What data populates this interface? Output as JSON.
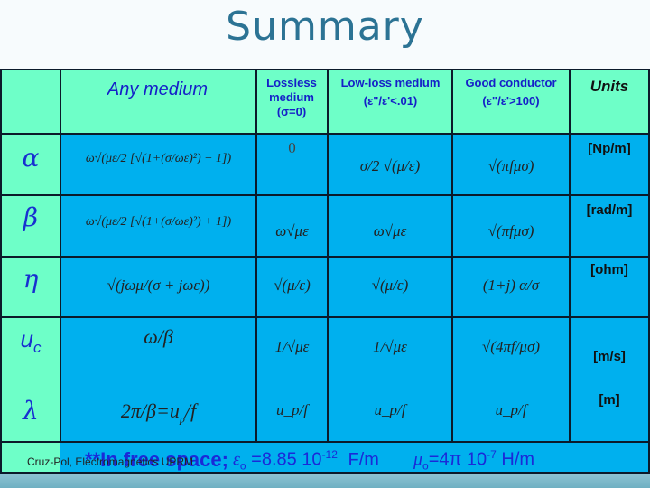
{
  "title": "Summary",
  "table": {
    "headers": {
      "any_medium": "Any medium",
      "lossless": [
        "Lossless",
        "medium",
        "(σ=0)"
      ],
      "low_loss": [
        "Low-loss medium",
        "(ε\"/ε'<.01)"
      ],
      "good_conductor": [
        "Good conductor",
        "(ε\"/ε'>100)"
      ],
      "units": "Units"
    },
    "rows": [
      {
        "symbol": "α",
        "any": "ω√(με/2 [√(1+(σ/ωε)²) − 1])",
        "lossless": "0",
        "low_loss": "σ/2 √(μ/ε)",
        "good": "√(πfμσ)",
        "unit": "[Np/m]"
      },
      {
        "symbol": "β",
        "any": "ω√(με/2 [√(1+(σ/ωε)²) + 1])",
        "lossless": "ω√με",
        "low_loss": "ω√με",
        "good": "√(πfμσ)",
        "unit": "[rad/m]"
      },
      {
        "symbol": "η",
        "any": "√(jωμ/(σ + jωε))",
        "lossless": "√(μ/ε)",
        "low_loss": "√(μ/ε)",
        "good": "(1+j) α/σ",
        "unit": "[ohm]"
      },
      {
        "symbol": "u",
        "symbol_sub": "c",
        "any": "ω/β",
        "lossless": "1/√με",
        "low_loss": "1/√με",
        "good": "√(4πf/μσ)",
        "unit": "[m/s]"
      },
      {
        "symbol": "λ",
        "any": "2π/β=u",
        "any_sub": "p",
        "any_tail": "/f",
        "lossless": "u_p/f",
        "low_loss": "u_p/f",
        "good": "u_p/f",
        "unit": "[m]"
      }
    ],
    "footer": {
      "credit": "Cruz-Pol, Electromagnetics UPRM",
      "free_space": "**In free space;",
      "eps_sym": "ε",
      "eps_sub": "o",
      "eps_val": "=8.85 10",
      "eps_exp": "-12",
      "eps_unit": "F/m",
      "mu_sym": "μ",
      "mu_sub": "o",
      "mu_val": "=4π 10",
      "mu_exp": "-7",
      "mu_unit": "H/m"
    }
  },
  "colors": {
    "header_bg": "#6effc8",
    "body_bg": "#00b0ee",
    "title": "#2c7394",
    "header_text": "#1520c8"
  }
}
